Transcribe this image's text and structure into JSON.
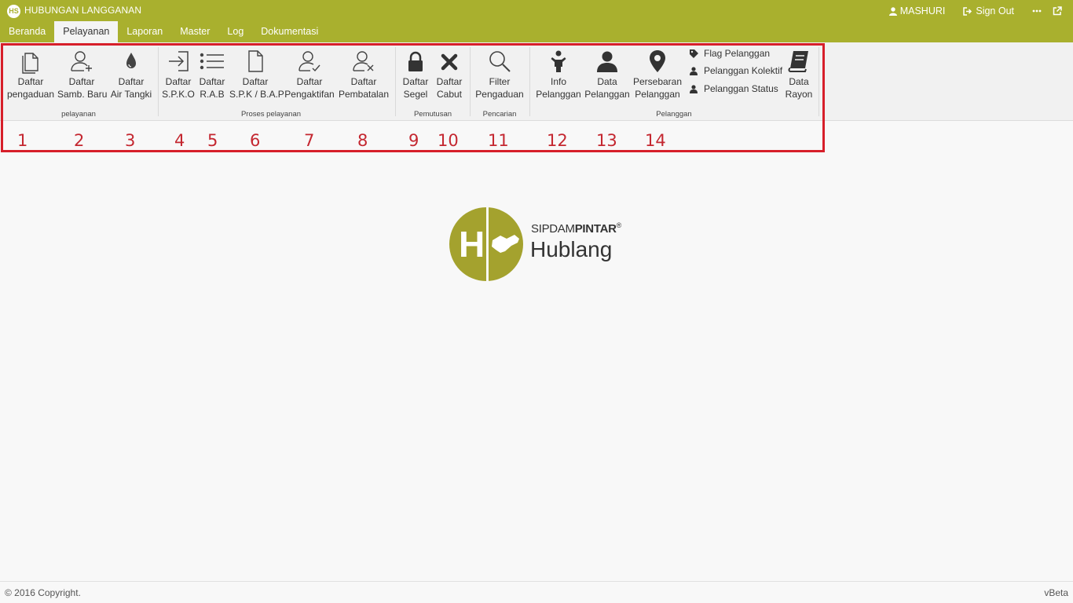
{
  "app": {
    "title": "HUBUNGAN LANGGANAN",
    "logo_text": "HS"
  },
  "user": {
    "name": "MASHURI",
    "signout": "Sign Out"
  },
  "menu": [
    "Beranda",
    "Pelayanan",
    "Laporan",
    "Master",
    "Log",
    "Dokumentasi"
  ],
  "menu_active": "Pelayanan",
  "ribbon": {
    "groups": [
      "pelayanan",
      "Proses pelayanan",
      "Pemutusan",
      "Pencarian",
      "Pelanggan"
    ],
    "buttons": [
      {
        "l1": "Daftar",
        "l2": "pengaduan",
        "icon": "document-copy-icon"
      },
      {
        "l1": "Daftar",
        "l2": "Samb. Baru",
        "icon": "user-add-icon"
      },
      {
        "l1": "Daftar",
        "l2": "Air Tangki",
        "icon": "water-drop-icon"
      },
      {
        "l1": "Daftar",
        "l2": "S.P.K.O",
        "icon": "sign-in-icon"
      },
      {
        "l1": "Daftar",
        "l2": "R.A.B",
        "icon": "list-icon"
      },
      {
        "l1": "Daftar",
        "l2": "S.P.K / B.A.P",
        "icon": "document-icon"
      },
      {
        "l1": "Daftar",
        "l2": "Pengaktifan",
        "icon": "user-check-icon"
      },
      {
        "l1": "Daftar",
        "l2": "Pembatalan",
        "icon": "user-remove-icon"
      },
      {
        "l1": "Daftar",
        "l2": "Segel",
        "icon": "lock-icon"
      },
      {
        "l1": "Daftar",
        "l2": "Cabut",
        "icon": "close-icon"
      },
      {
        "l1": "Filter",
        "l2": "Pengaduan",
        "icon": "search-icon"
      },
      {
        "l1": "Info",
        "l2": "Pelanggan",
        "icon": "person-icon"
      },
      {
        "l1": "Data",
        "l2": "Pelanggan",
        "icon": "user-icon"
      },
      {
        "l1": "Persebaran",
        "l2": "Pelanggan",
        "icon": "map-marker-icon"
      },
      {
        "l1": "Data",
        "l2": "Rayon",
        "icon": "book-icon"
      }
    ],
    "small_buttons": [
      "Flag Pelanggan",
      "Pelanggan Kolektif",
      "Pelanggan Status"
    ]
  },
  "annotations": [
    "1",
    "2",
    "3",
    "4",
    "5",
    "6",
    "7",
    "8",
    "9",
    "10",
    "11",
    "12",
    "13",
    "14"
  ],
  "brand": {
    "letter": "H",
    "small_light": "SIPDAM",
    "small_bold": "PINTAR",
    "reg": "®",
    "big": "Hublang"
  },
  "footer": {
    "copyright": "© 2016 Copyright.",
    "version": "vBeta"
  },
  "colors": {
    "topbar": "#a9b02e",
    "highlight": "#d71f2a",
    "annotation": "#c42730"
  }
}
